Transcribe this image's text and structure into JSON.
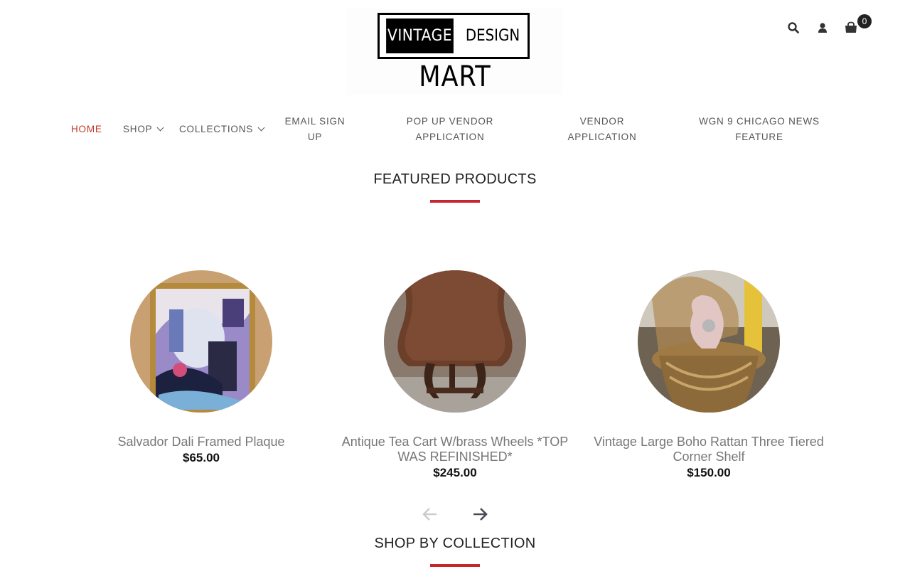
{
  "brand": {
    "logo_left": "VINTAGE",
    "logo_right": "DESIGN",
    "logo_bottom": "MART"
  },
  "header": {
    "cart_count": "0"
  },
  "nav": [
    {
      "label": "HOME"
    },
    {
      "label": "SHOP"
    },
    {
      "label": "COLLECTIONS"
    },
    {
      "label": "EMAIL SIGN UP"
    },
    {
      "label": "POP UP VENDOR APPLICATION"
    },
    {
      "label": "VENDOR APPLICATION"
    },
    {
      "label": "WGN 9 CHICAGO NEWS FEATURE"
    }
  ],
  "featured": {
    "title": "FEATURED PRODUCTS",
    "products": [
      {
        "name": "Salvador Dali Framed Plaque",
        "price": "$65.00"
      },
      {
        "name": "Antique Tea Cart W/brass Wheels *TOP WAS REFINISHED*",
        "price": "$245.00"
      },
      {
        "name": "Vintage Large Boho Rattan Three Tiered Corner Shelf",
        "price": "$150.00"
      }
    ]
  },
  "collection": {
    "title": "SHOP BY COLLECTION"
  },
  "colors": {
    "accent": "#c8262e",
    "nav_active": "#c0392b",
    "icon": "#333333"
  },
  "icons": [
    "search-icon",
    "user-icon",
    "shopping-bag-icon",
    "arrow-left-icon",
    "arrow-right-icon"
  ]
}
